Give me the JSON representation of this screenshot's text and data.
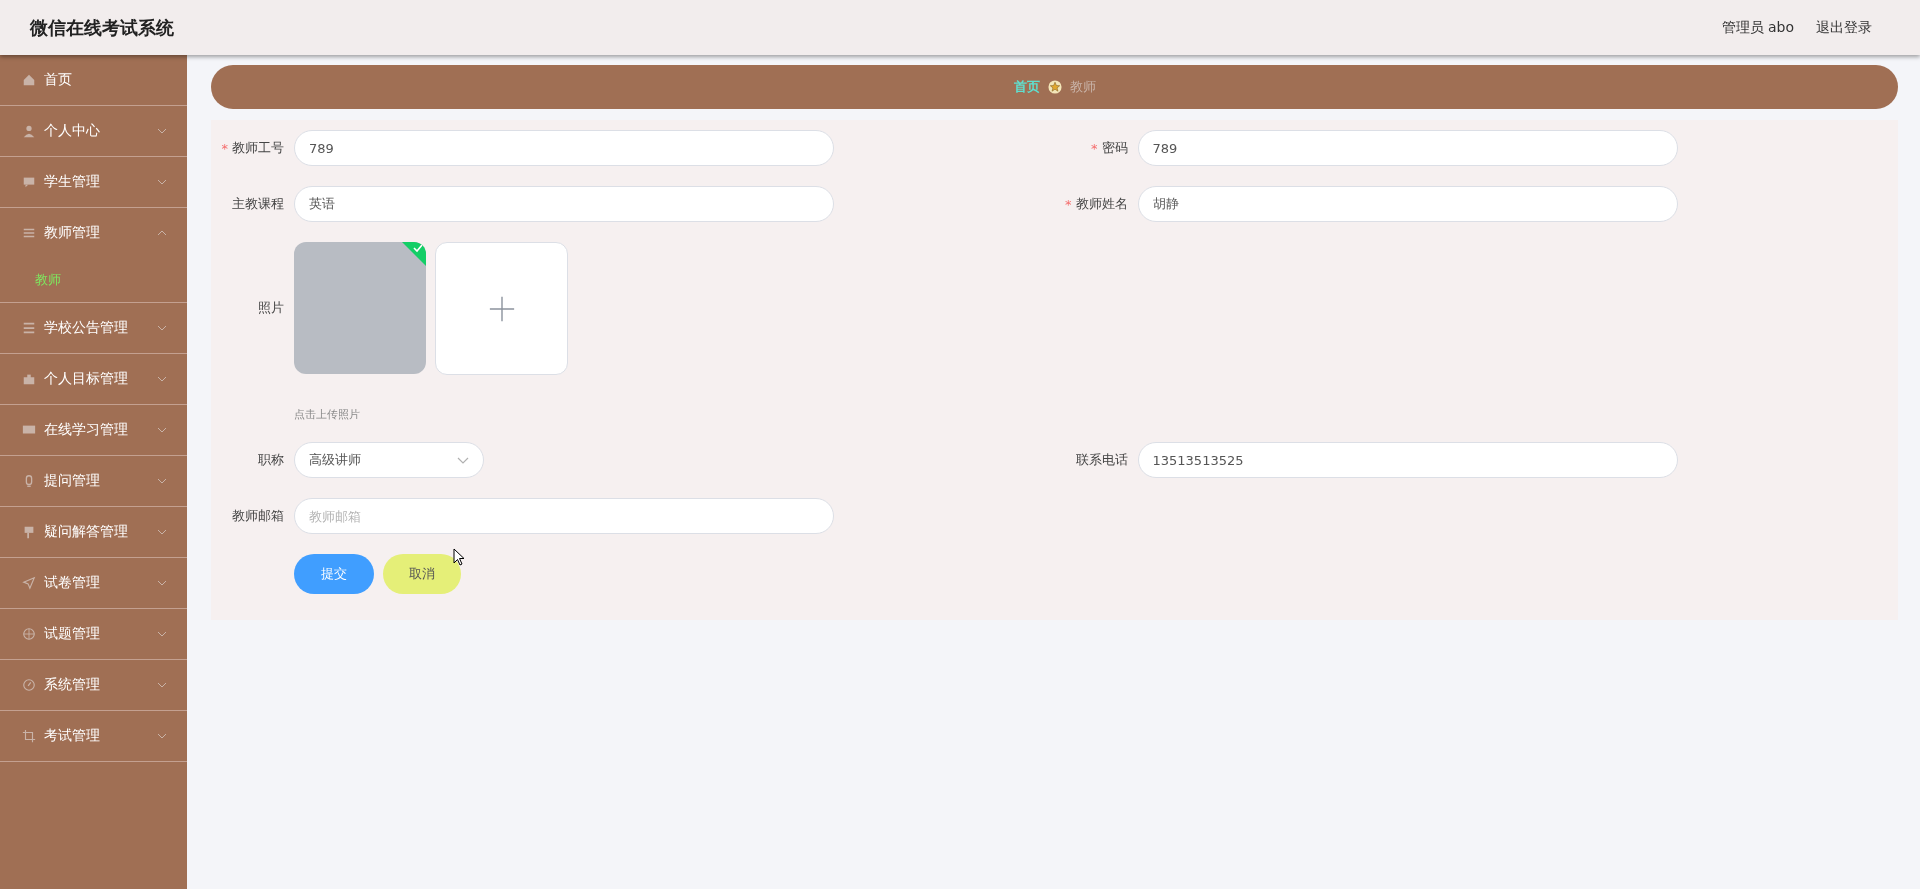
{
  "header": {
    "title": "微信在线考试系统",
    "user": "管理员 abo",
    "logout": "退出登录"
  },
  "sidebar": {
    "items": [
      {
        "label": "首页",
        "kind": "link"
      },
      {
        "label": "个人中心",
        "kind": "menu",
        "expanded": false
      },
      {
        "label": "学生管理",
        "kind": "menu",
        "expanded": false
      },
      {
        "label": "教师管理",
        "kind": "menu",
        "expanded": true,
        "children": [
          {
            "label": "教师",
            "selected": true
          }
        ]
      },
      {
        "label": "学校公告管理",
        "kind": "menu",
        "expanded": false
      },
      {
        "label": "个人目标管理",
        "kind": "menu",
        "expanded": false
      },
      {
        "label": "在线学习管理",
        "kind": "menu",
        "expanded": false
      },
      {
        "label": "提问管理",
        "kind": "menu",
        "expanded": false
      },
      {
        "label": "疑问解答管理",
        "kind": "menu",
        "expanded": false
      },
      {
        "label": "试卷管理",
        "kind": "menu",
        "expanded": false
      },
      {
        "label": "试题管理",
        "kind": "menu",
        "expanded": false
      },
      {
        "label": "系统管理",
        "kind": "menu",
        "expanded": false
      },
      {
        "label": "考试管理",
        "kind": "menu",
        "expanded": false
      }
    ]
  },
  "breadcrumb": [
    {
      "label": "首页",
      "current": false
    },
    {
      "label": "教师",
      "current": true
    }
  ],
  "form": {
    "required_mark": "*",
    "rows": [
      [
        {
          "kind": "input",
          "label": "教师工号",
          "required": true,
          "value": "789"
        },
        {
          "kind": "input",
          "label": "密码",
          "required": true,
          "value": "789"
        }
      ],
      [
        {
          "kind": "input",
          "label": "主教课程",
          "required": false,
          "value": "英语"
        },
        {
          "kind": "input",
          "label": "教师姓名",
          "required": true,
          "value": "胡静"
        }
      ],
      [
        {
          "kind": "upload",
          "label": "照片",
          "required": false,
          "uploaded": true,
          "hint": "点击上传照片"
        }
      ],
      [
        {
          "kind": "select",
          "label": "职称",
          "required": false,
          "value": "高级讲师"
        },
        {
          "kind": "input",
          "label": "联系电话",
          "required": false,
          "value": "13513513525"
        }
      ],
      [
        {
          "kind": "input",
          "label": "教师邮箱",
          "required": false,
          "placeholder": "教师邮箱"
        }
      ]
    ],
    "buttons": [
      {
        "label": "提交",
        "kind": "primary"
      },
      {
        "label": "取消",
        "kind": "secondary"
      }
    ]
  }
}
